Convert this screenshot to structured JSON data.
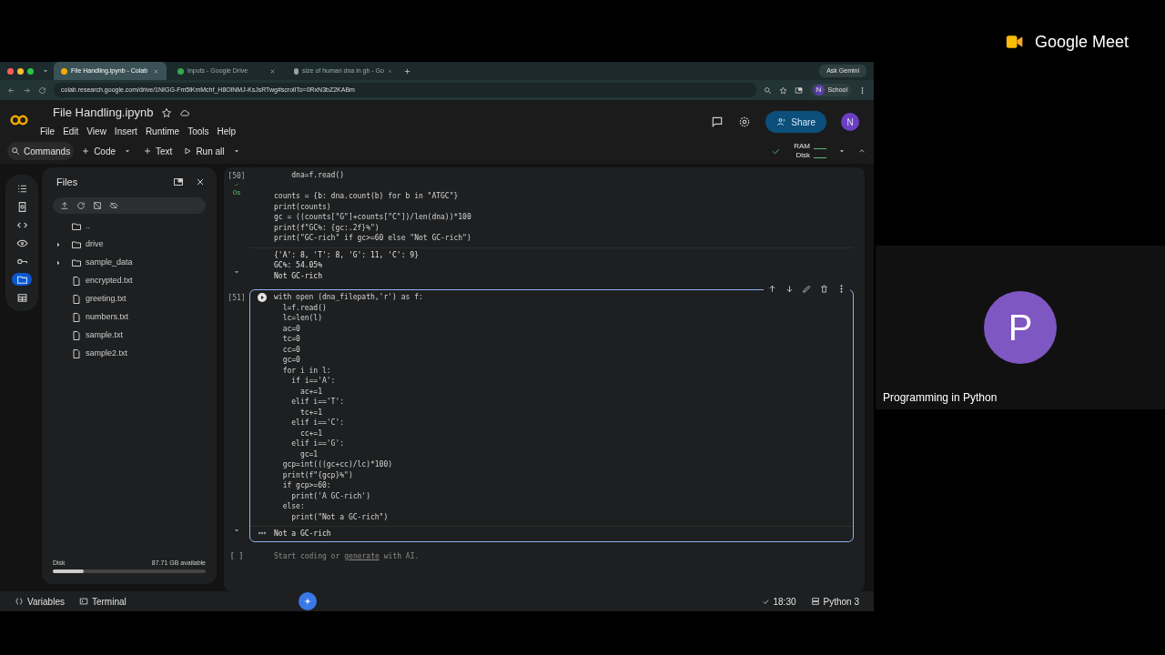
{
  "browser": {
    "tabs": [
      {
        "title": "File Handling.ipynb - Colab",
        "selected": true
      },
      {
        "title": "Inputs - Google Drive",
        "selected": false
      },
      {
        "title": "size of human dna in gb - Go",
        "selected": false
      }
    ],
    "ask_gemini": "Ask Gemini",
    "url": "colab.research.google.com/drive/1NIGG-Fm5lKmMchf_H8OlNMJ-KsJsRTwg#scrollTo=0RxN3bZ2KABm",
    "profile": {
      "initial": "N",
      "label": "School"
    }
  },
  "colab": {
    "title": "File Handling.ipynb",
    "menu": [
      "File",
      "Edit",
      "View",
      "Insert",
      "Runtime",
      "Tools",
      "Help"
    ],
    "share": "Share",
    "avatar": "N",
    "toolbar": [
      "Commands",
      "Code",
      "Text",
      "Run all"
    ],
    "resources": [
      "RAM",
      "Disk"
    ]
  },
  "rail": [
    {
      "selected": false
    },
    {
      "selected": false
    },
    {
      "selected": false
    },
    {
      "selected": false
    },
    {
      "selected": false
    },
    {
      "selected": true
    },
    {
      "selected": false
    }
  ],
  "files": {
    "title": "Files",
    "items": [
      {
        "kind": "folder",
        "name": ".."
      },
      {
        "kind": "folder",
        "name": "drive",
        "expanded": false
      },
      {
        "kind": "folder",
        "name": "sample_data",
        "expanded": false
      },
      {
        "kind": "file",
        "name": "encrypted.txt"
      },
      {
        "kind": "file",
        "name": "greeting.txt"
      },
      {
        "kind": "file",
        "name": "numbers.txt"
      },
      {
        "kind": "file",
        "name": "sample.txt"
      },
      {
        "kind": "file",
        "name": "sample2.txt"
      }
    ],
    "disk_label": "Disk",
    "disk_free": "87.71 GB available",
    "level": 0.2
  },
  "cells": [
    {
      "prompt": "[50]",
      "status": "0s",
      "selected": false,
      "code": [
        "    dna=f.read()\n\ncounts = {b: dna.count(b) for b in \"ATGC\"}",
        "print(counts)",
        "gc = ((counts[\"G\"]+counts[\"C\"])/len(dna))*100",
        "print(f\"GC%: {gc:.2f}%\")",
        "print(\"GC-rich\" if gc>=60 else \"Not GC-rich\")"
      ],
      "output": [
        "{'A': 8, 'T': 8, 'G': 11, 'C': 9}",
        "GC%: 54.05%",
        "Not GC-rich"
      ]
    },
    {
      "prompt": "[51]",
      "selected": true,
      "code": [
        "with open (dna_filepath,'r') as f:",
        "  l=f.read()",
        "  lc=len(l)",
        "  ac=0",
        "  tc=0",
        "  cc=0",
        "  gc=0",
        "  for i in l:",
        "    if i=='A':",
        "      ac+=1",
        "    elif i=='T':",
        "      tc+=1",
        "    elif i=='C':",
        "      cc+=1",
        "    elif i=='G':",
        "      gc=1",
        "  gcp=int(((gc+cc)/lc)*100)",
        "  print(f\"{gcp}%\")",
        "  if gcp>=60:",
        "    print('A GC-rich')",
        "  else:",
        "    print(\"Not a GC-rich\")"
      ],
      "output": [
        "Not a GC-rich"
      ]
    },
    {
      "prompt": "[ ]",
      "selected": false,
      "placeholder": "Start coding or",
      "link": "generate",
      "placeholder_end": "with AI."
    }
  ],
  "status_bar": {
    "items": [
      "Variables",
      "Terminal"
    ],
    "time": "18:30",
    "runtime": "Python 3"
  },
  "meet": {
    "logo": "Google Meet",
    "participant": {
      "initial": "P",
      "name": "Programming in Python"
    }
  }
}
